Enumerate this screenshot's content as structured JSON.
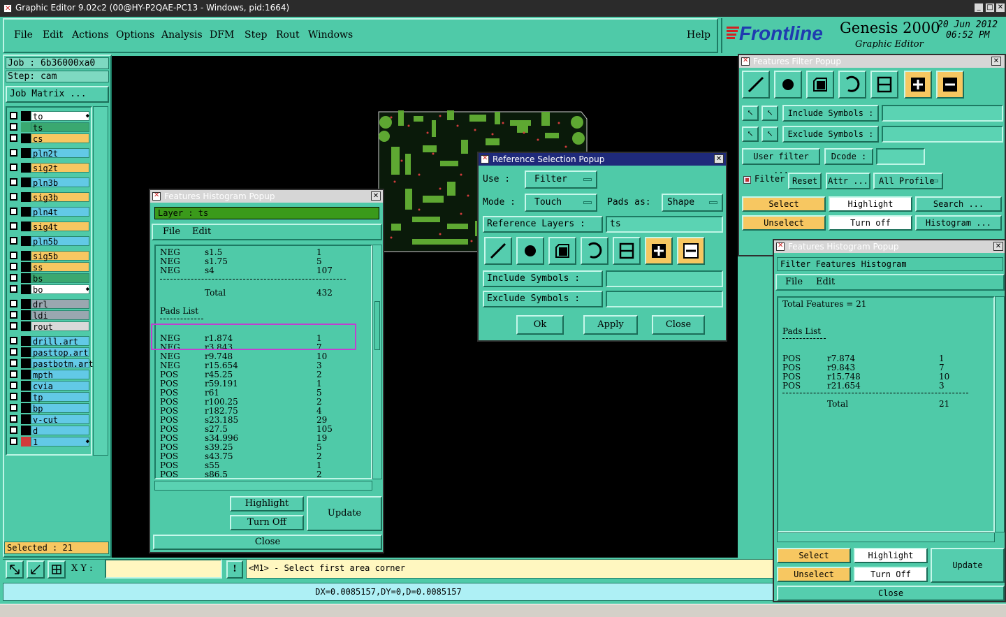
{
  "window": {
    "title": "Graphic Editor 9.02c2 (00@HY-P2QAE-PC13 - Windows, pid:1664)"
  },
  "menu": [
    "File",
    "Edit",
    "Actions",
    "Options",
    "Analysis",
    "DFM",
    "Step",
    "Rout",
    "Windows"
  ],
  "help_label": "Help",
  "brand": {
    "logo": "Frontline",
    "product": "Genesis 2000",
    "subtitle": "Graphic Editor",
    "date": "20 Jun 2012",
    "time": "06:52 PM"
  },
  "job": {
    "job_label": "Job  : 6b36000xa0",
    "step_label": "Step: cam",
    "matrix_button": "Job Matrix ..."
  },
  "layers": [
    {
      "name": "to",
      "color": "#ffffff",
      "swatch": "#000000",
      "marker": true
    },
    {
      "name": "ts",
      "color": "#3aa870",
      "swatch": "#3aa870"
    },
    {
      "name": "cs",
      "color": "#f7c761",
      "swatch": "#000000"
    },
    {
      "name": "pln2t",
      "color": "#62c9e6",
      "swatch": "#000000"
    },
    {
      "name": "sig2t",
      "color": "#f7c761",
      "swatch": "#000000"
    },
    {
      "name": "pln3b",
      "color": "#62c9e6",
      "swatch": "#000000"
    },
    {
      "name": "sig3b",
      "color": "#f7c761",
      "swatch": "#000000"
    },
    {
      "name": "pln4t",
      "color": "#62c9e6",
      "swatch": "#000000"
    },
    {
      "name": "sig4t",
      "color": "#f7c761",
      "swatch": "#000000"
    },
    {
      "name": "pln5b",
      "color": "#62c9e6",
      "swatch": "#000000"
    },
    {
      "name": "sig5b",
      "color": "#f7c761",
      "swatch": "#000000"
    },
    {
      "name": "ss",
      "color": "#f7c761",
      "swatch": "#000000"
    },
    {
      "name": "bs",
      "color": "#3aa870",
      "swatch": "#000000"
    },
    {
      "name": "bo",
      "color": "#ffffff",
      "swatch": "#000000",
      "marker": true
    },
    {
      "name": "drl",
      "color": "#9aa7b0",
      "swatch": "#000000"
    },
    {
      "name": "ldi",
      "color": "#9aa7b0",
      "swatch": "#000000"
    },
    {
      "name": "rout",
      "color": "#d9d9d9",
      "swatch": "#000000"
    },
    {
      "name": "drill.art",
      "color": "#62c9e6",
      "swatch": "#000000"
    },
    {
      "name": "pasttop.art",
      "color": "#62c9e6",
      "swatch": "#000000"
    },
    {
      "name": "pastbotm.art",
      "color": "#62c9e6",
      "swatch": "#000000"
    },
    {
      "name": "mpth",
      "color": "#62c9e6",
      "swatch": "#000000"
    },
    {
      "name": "cvia",
      "color": "#62c9e6",
      "swatch": "#000000"
    },
    {
      "name": "tp",
      "color": "#62c9e6",
      "swatch": "#000000"
    },
    {
      "name": "bp",
      "color": "#62c9e6",
      "swatch": "#000000"
    },
    {
      "name": "v-cut",
      "color": "#62c9e6",
      "swatch": "#000000"
    },
    {
      "name": "d",
      "color": "#62c9e6",
      "swatch": "#000000"
    },
    {
      "name": "1",
      "color": "#62c9e6",
      "swatch": "#d23b3b",
      "marker": true
    }
  ],
  "selected_label": "Selected : 21",
  "statusbar": {
    "xy_label": "X Y :",
    "xy_value": "",
    "prompt": "<M1> - Select first area corner",
    "coords": "DX=0.0085157,DY=0,D=0.0085157"
  },
  "histogram_left": {
    "title": "Features Histogram Popup",
    "layer_label": "Layer :  ts",
    "menu": [
      "File",
      "Edit"
    ],
    "rows_top": [
      [
        "NEG",
        "s1.5",
        "1"
      ],
      [
        "NEG",
        "s1.75",
        "5"
      ],
      [
        "NEG",
        "s4",
        "107"
      ]
    ],
    "total_label": "Total",
    "total_value": "432",
    "pads_title": "Pads List",
    "pads": [
      [
        "NEG",
        "r1.874",
        "1"
      ],
      [
        "NEG",
        "r3.843",
        "7"
      ],
      [
        "NEG",
        "r9.748",
        "10"
      ],
      [
        "NEG",
        "r15.654",
        "3"
      ],
      [
        "POS",
        "r45.25",
        "2"
      ],
      [
        "POS",
        "r59.191",
        "1"
      ],
      [
        "POS",
        "r61",
        "5"
      ],
      [
        "POS",
        "r100.25",
        "2"
      ],
      [
        "POS",
        "r182.75",
        "4"
      ],
      [
        "POS",
        "s23.185",
        "29"
      ],
      [
        "POS",
        "s27.5",
        "105"
      ],
      [
        "POS",
        "s34.996",
        "19"
      ],
      [
        "POS",
        "s39.25",
        "5"
      ],
      [
        "POS",
        "s43.75",
        "2"
      ],
      [
        "POS",
        "s55",
        "1"
      ],
      [
        "POS",
        "s86.5",
        "2"
      ]
    ],
    "highlight_btn": "Highlight",
    "turnoff_btn": "Turn Off",
    "update_btn": "Update",
    "close_btn": "Close"
  },
  "refsel": {
    "title": "Reference Selection Popup",
    "use_label": "Use   :",
    "use_value": "Filter",
    "mode_label": "Mode  :",
    "mode_value": "Touch",
    "pads_as_label": "Pads as:",
    "pads_as_value": "Shape",
    "ref_layers_label": "Reference Layers  :",
    "ref_layers_value": "ts",
    "include_label": "Include Symbols  :",
    "exclude_label": "Exclude Symbols  :",
    "ok": "Ok",
    "apply": "Apply",
    "close": "Close"
  },
  "filter": {
    "title": "Features Filter Popup",
    "include_label": "Include Symbols :",
    "exclude_label": "Exclude Symbols :",
    "user_filter": "User filter ...",
    "dcode": "Dcode :",
    "filter_label": "Filter",
    "reset": "Reset",
    "attr": "Attr ...",
    "all_profile": "All Profile",
    "select": "Select",
    "highlight": "Highlight",
    "search": "Search ...",
    "unselect": "Unselect",
    "turn_off": "Turn off",
    "histogram": "Histogram ..."
  },
  "histogram_right": {
    "title": "Features Histogram Popup",
    "header": "Filter Features Histogram",
    "menu": [
      "File",
      "Edit"
    ],
    "total_features": "Total Features = 21",
    "pads_title": "Pads List",
    "pads": [
      [
        "POS",
        "r7.874",
        "1"
      ],
      [
        "POS",
        "r9.843",
        "7"
      ],
      [
        "POS",
        "r15.748",
        "10"
      ],
      [
        "POS",
        "r21.654",
        "3"
      ]
    ],
    "total_label": "Total",
    "total_value": "21",
    "select": "Select",
    "highlight": "Highlight",
    "update": "Update",
    "unselect": "Unselect",
    "turn_off": "Turn Off",
    "close": "Close"
  }
}
